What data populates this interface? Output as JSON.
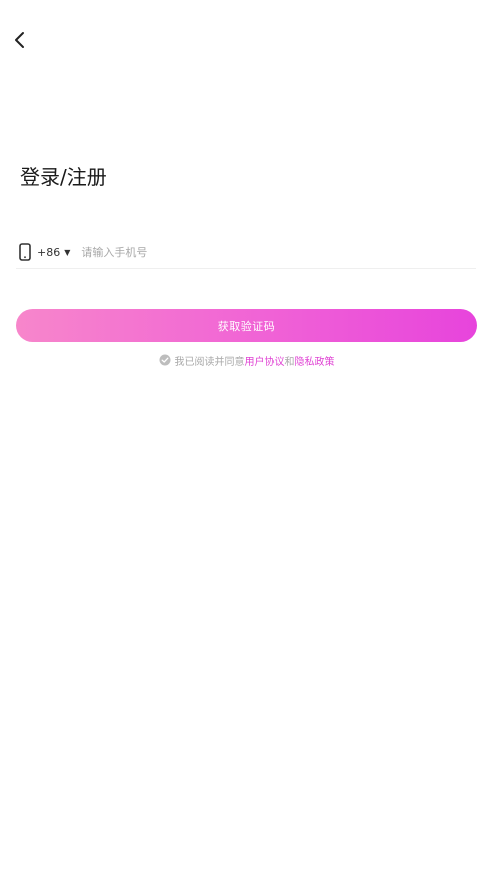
{
  "header": {
    "back_icon": "chevron-left-icon"
  },
  "page": {
    "title": "登录/注册"
  },
  "phone": {
    "icon": "phone-icon",
    "country_code": "+86",
    "caret": "▼",
    "placeholder": "请输入手机号",
    "value": ""
  },
  "actions": {
    "get_code_label": "获取验证码"
  },
  "agreement": {
    "check_icon": "check-circle-icon",
    "prefix": "我已阅读并同意",
    "user_agreement": "用户协议",
    "conjunction": "和",
    "privacy_policy": "隐私政策"
  },
  "colors": {
    "accent": "#e044d4",
    "button_gradient_start": "#f786cb",
    "button_gradient_end": "#e744dc",
    "muted_text": "#a8a8a8",
    "divider": "#efefef"
  }
}
